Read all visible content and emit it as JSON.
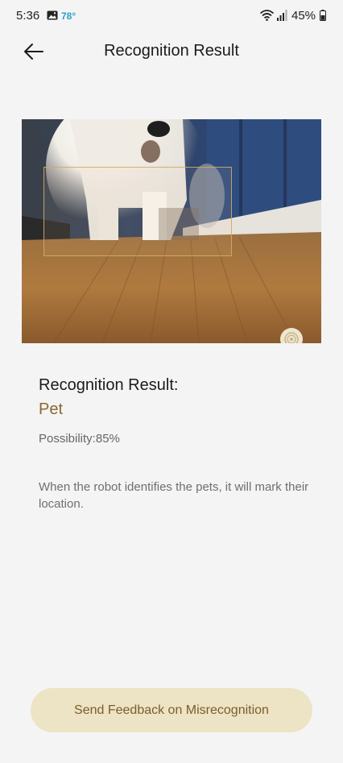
{
  "status_bar": {
    "time": "5:36",
    "temperature": "78°",
    "battery": "45%",
    "icons": [
      "gallery-icon",
      "wifi-icon",
      "signal-icon",
      "battery-icon"
    ]
  },
  "app_bar": {
    "title": "Recognition Result",
    "back_icon": "arrow-left-icon"
  },
  "camera": {
    "fullscreen_icon": "target-icon"
  },
  "result": {
    "label": "Recognition Result:",
    "value": "Pet",
    "possibility": "Possibility:85%"
  },
  "hint": "When the robot identifies the pets, it will mark their location.",
  "feedback_button": "Send Feedback on Misrecognition",
  "colors": {
    "accent": "#8a6a2e",
    "button_bg": "#ede3c5",
    "temperature": "#2a9fc8"
  }
}
